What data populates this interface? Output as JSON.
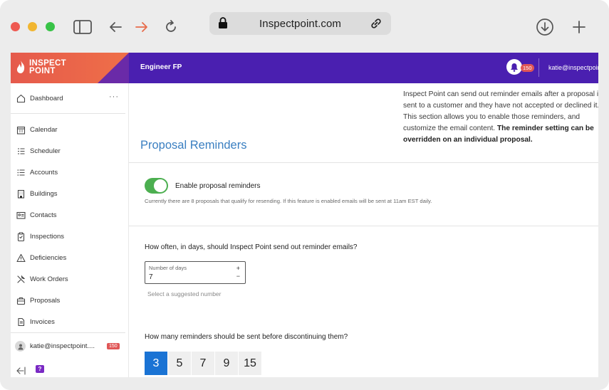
{
  "browser": {
    "url": "Inspectpoint.com"
  },
  "header": {
    "brand_line1": "INSPECT",
    "brand_line2": "POINT",
    "workspace": "Engineer FP",
    "notification_count": "150",
    "user_email": "katie@inspectpoint.com"
  },
  "sidebar": {
    "dashboard": "Dashboard",
    "more": "···",
    "items": [
      {
        "label": "Calendar",
        "icon": "calendar-icon"
      },
      {
        "label": "Scheduler",
        "icon": "scheduler-icon"
      },
      {
        "label": "Accounts",
        "icon": "list-icon"
      },
      {
        "label": "Buildings",
        "icon": "building-icon"
      },
      {
        "label": "Contacts",
        "icon": "contact-card-icon"
      },
      {
        "label": "Inspections",
        "icon": "clipboard-icon"
      },
      {
        "label": "Deficiencies",
        "icon": "warning-icon"
      },
      {
        "label": "Work Orders",
        "icon": "wrench-icon"
      },
      {
        "label": "Proposals",
        "icon": "briefcase-icon"
      },
      {
        "label": "Invoices",
        "icon": "invoice-icon"
      }
    ],
    "user_email": "katie@inspectpoint....",
    "user_badge": "150",
    "chat_label": "?"
  },
  "main": {
    "title": "Proposal Reminders",
    "description_plain": "Inspect Point can send out reminder emails after a proposal is sent to a customer and they have not accepted or declined it. This section allows you to enable those reminders, and customize the email content.",
    "description_bold": "The reminder setting can be overridden on an individual proposal.",
    "toggle_label": "Enable proposal reminders",
    "toggle_enabled": true,
    "toggle_note": "Currently there are 8 proposals that qualify for resending. If this feature is enabled emails will be sent at 11am EST daily.",
    "question_frequency": "How often, in days, should Inspect Point send out reminder emails?",
    "days_field_label": "Number of days",
    "days_field_value": "7",
    "plus": "+",
    "minus": "−",
    "helper_text": "Select a suggested number",
    "question_count": "How many reminders should be sent before discontinuing them?",
    "reminder_options": [
      "3",
      "5",
      "7",
      "9",
      "15"
    ],
    "selected_option": "3"
  },
  "colors": {
    "topbar": "#4a1fb0",
    "brand": "#e85d4a",
    "accent_blue": "#3a7fc1",
    "toggle_on": "#4caf50",
    "selected_pill": "#1a73d4",
    "badge": "#e05656"
  }
}
